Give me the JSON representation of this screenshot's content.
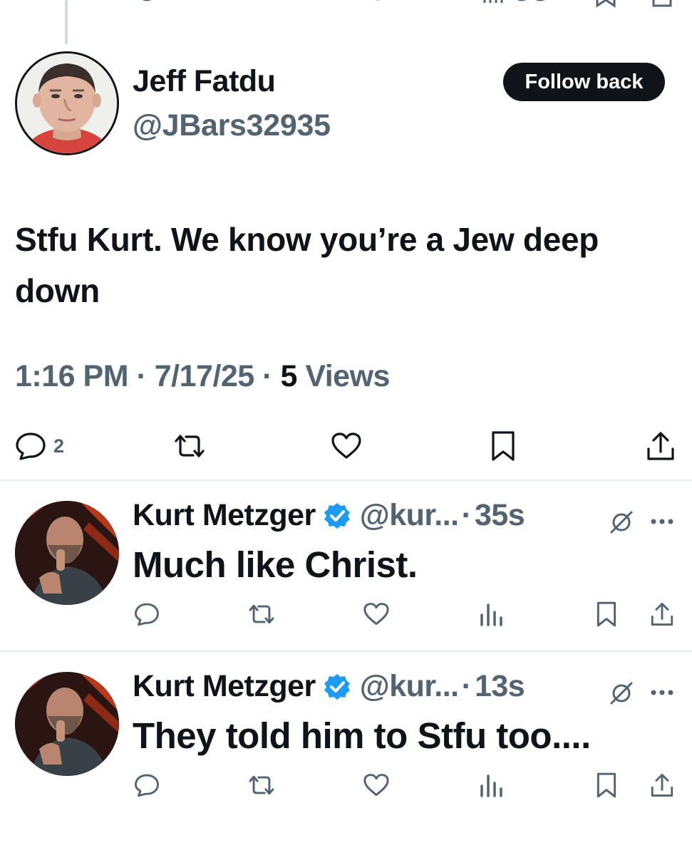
{
  "main_tweet": {
    "author_name": "Jeff Fatdu",
    "author_handle": "@JBars32935",
    "follow_label": "Follow back",
    "text": "Stfu Kurt. We know you’re a Jew deep down",
    "time": "1:16 PM",
    "date": "7/17/25",
    "views_count": "5",
    "views_label": "Views",
    "meta_separator": "·",
    "reply_count": "2",
    "icons": [
      "reply-icon",
      "retweet-icon",
      "like-icon",
      "bookmark-icon",
      "share-icon"
    ]
  },
  "replies": [
    {
      "author_name": "Kurt Metzger",
      "verified": true,
      "author_handle": "@kur...",
      "time": "35s",
      "text": "Much like Christ."
    },
    {
      "author_name": "Kurt Metzger",
      "verified": true,
      "author_handle": "@kur...",
      "time": "13s",
      "text": "They told him to Stfu too...."
    }
  ],
  "separator": "·",
  "colors": {
    "text": "#0f1419",
    "secondary": "#536471",
    "verified": "#1d9bf0",
    "follow_button_bg": "#0f1419",
    "divider": "#e6ecf0"
  }
}
